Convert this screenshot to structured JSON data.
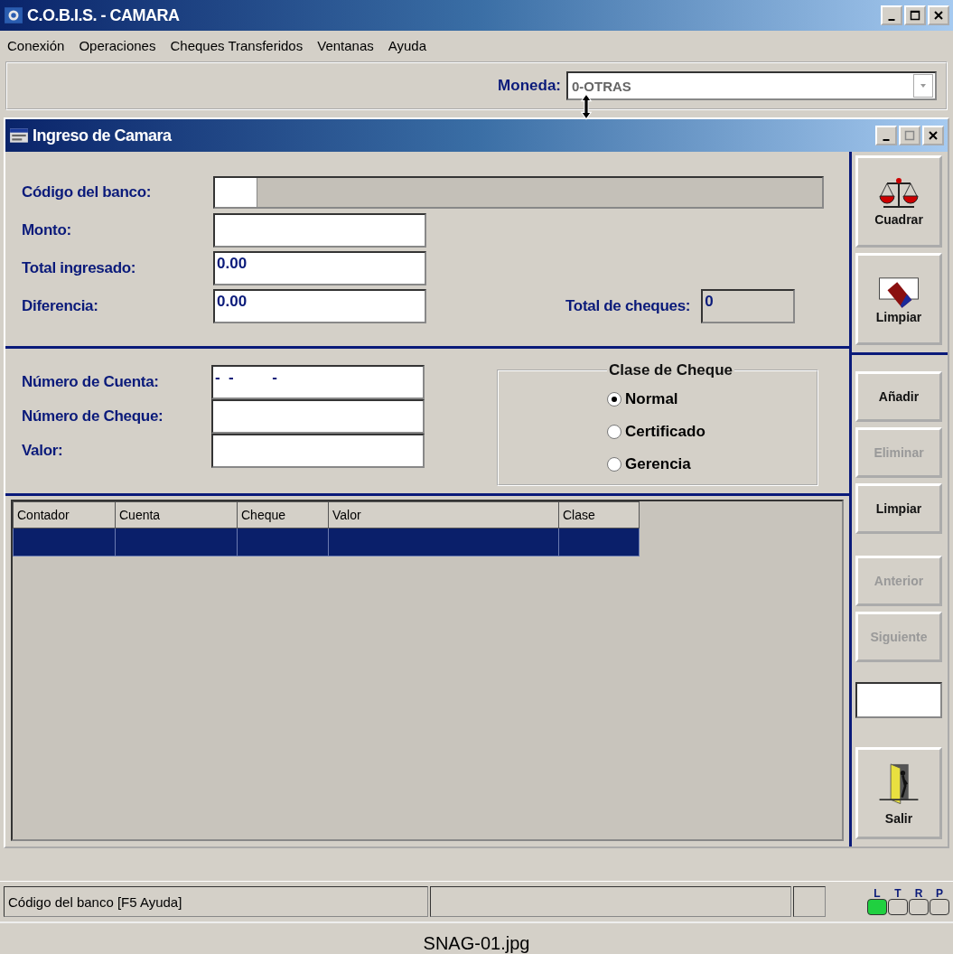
{
  "window": {
    "title": "C.O.B.I.S. - CAMARA"
  },
  "menu": [
    "Conexión",
    "Operaciones",
    "Cheques Transferidos",
    "Ventanas",
    "Ayuda"
  ],
  "currency": {
    "label": "Moneda:",
    "value": "0-OTRAS"
  },
  "child_window": {
    "title": "Ingreso de Camara"
  },
  "bank_fields": [
    {
      "label": "Código del banco:",
      "kind": "code"
    },
    {
      "label": "Monto:",
      "kind": "text"
    },
    {
      "label": "Total ingresado:",
      "kind": "text",
      "value": "0.00"
    },
    {
      "label": "Diferencia:",
      "kind": "text",
      "value": "0.00"
    }
  ],
  "total_cheques": {
    "label": "Total de cheques:",
    "value": "0"
  },
  "cheque_fields": [
    {
      "label": "Número de Cuenta:",
      "value": "-  -         -"
    },
    {
      "label": "Número de Cheque:"
    },
    {
      "label": "Valor:"
    }
  ],
  "cheque_class": {
    "title": "Clase de Cheque",
    "options": [
      {
        "label": "Normal",
        "selected": true
      },
      {
        "label": "Certificado",
        "selected": false
      },
      {
        "label": "Gerencia",
        "selected": false
      }
    ]
  },
  "grid": {
    "columns": [
      "Contador",
      "Cuenta",
      "Cheque",
      "Valor",
      "Clase"
    ],
    "rows": [
      {
        "selected": true
      }
    ]
  },
  "side_groups": [
    [
      {
        "label": "Cuadrar",
        "kind": "scale",
        "disabled": false
      },
      {
        "label": "Limpiar",
        "kind": "eraser",
        "disabled": false
      }
    ],
    [
      {
        "label": "Añadir",
        "kind": "plain",
        "disabled": false
      },
      {
        "label": "Eliminar",
        "kind": "plain",
        "disabled": true
      },
      {
        "label": "Limpiar",
        "kind": "plain",
        "disabled": false
      }
    ],
    [
      {
        "label": "Anterior",
        "kind": "plain",
        "disabled": true
      },
      {
        "label": "Siguiente",
        "kind": "plain",
        "disabled": true
      }
    ],
    [
      {
        "kind": "field"
      }
    ],
    [
      {
        "label": "Salir",
        "kind": "door",
        "disabled": false
      }
    ]
  ],
  "status_bar": {
    "text": "Código del banco [F5 Ayuda]",
    "indicators": [
      {
        "label": "L",
        "on": true
      },
      {
        "label": "T",
        "on": false
      },
      {
        "label": "R",
        "on": false
      },
      {
        "label": "P",
        "on": false
      }
    ]
  },
  "caption": "SNAG-01.jpg"
}
